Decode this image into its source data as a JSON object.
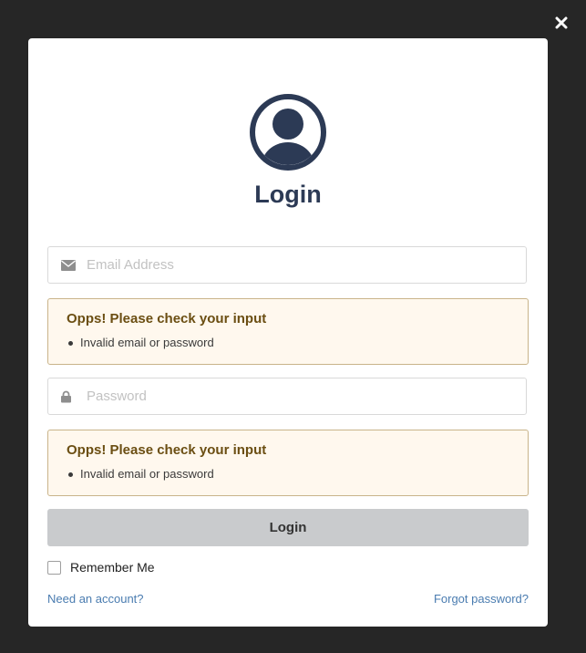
{
  "header": {
    "title": "Login"
  },
  "icons": {
    "close": "close-icon",
    "avatar": "user-avatar-icon",
    "email": "envelope-icon",
    "password": "lock-icon"
  },
  "email": {
    "placeholder": "Email Address",
    "value": ""
  },
  "email_error": {
    "title": "Opps! Please check your input",
    "items": [
      "Invalid email or password"
    ]
  },
  "password": {
    "placeholder": "Password",
    "value": ""
  },
  "password_error": {
    "title": "Opps! Please check your input",
    "items": [
      "Invalid email or password"
    ]
  },
  "actions": {
    "login_label": "Login",
    "remember_label": "Remember Me",
    "remember_checked": false,
    "need_account": "Need an account?",
    "forgot_password": "Forgot password?"
  },
  "colors": {
    "overlay": "#262626",
    "accent": "#2c3a55",
    "link": "#4a7cb0",
    "alert_bg": "#fff8ee",
    "alert_text": "#6b4e12",
    "button_bg": "#c9cbcd"
  }
}
